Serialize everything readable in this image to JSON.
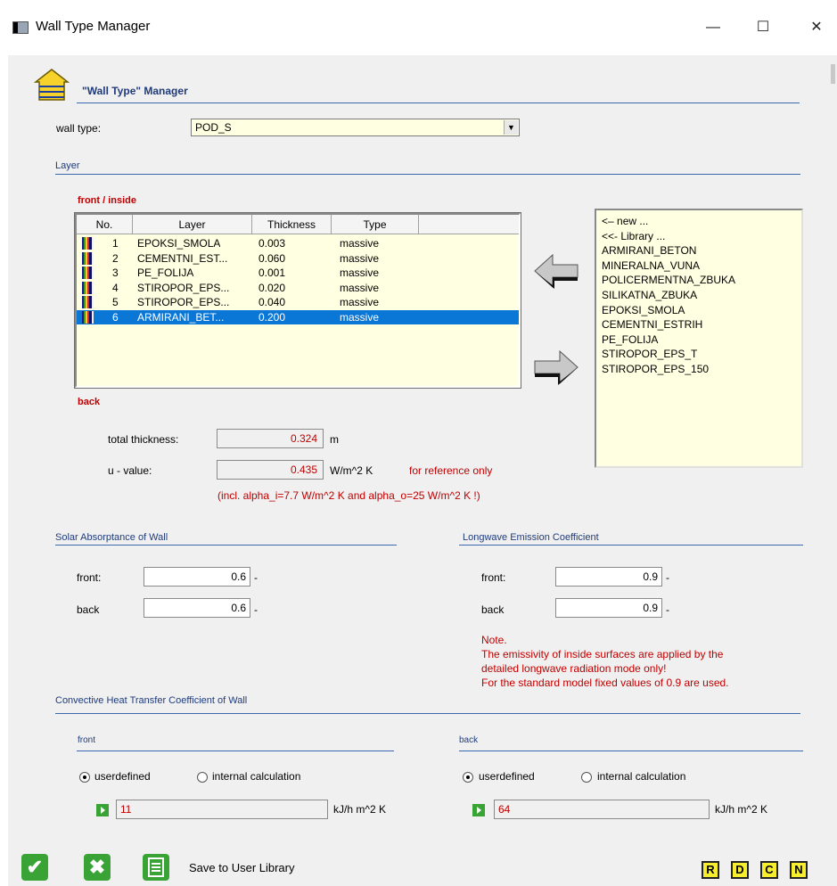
{
  "window": {
    "title": "Wall Type Manager",
    "minimize": "—",
    "maximize": "☐",
    "close": "✕"
  },
  "header": {
    "title": "\"Wall Type\" Manager",
    "icon": "house-icon"
  },
  "wall_type": {
    "label": "wall type:",
    "value": "POD_S"
  },
  "layer_section": {
    "title": "Layer",
    "front_label": "front / inside",
    "back_label": "back",
    "columns": [
      "No.",
      "Layer",
      "Thickness",
      "Type"
    ],
    "rows": [
      {
        "no": "1",
        "layer": "EPOKSI_SMOLA",
        "thickness": "0.003",
        "type": "massive"
      },
      {
        "no": "2",
        "layer": "CEMENTNI_EST...",
        "thickness": "0.060",
        "type": "massive"
      },
      {
        "no": "3",
        "layer": "PE_FOLIJA",
        "thickness": "0.001",
        "type": "massive"
      },
      {
        "no": "4",
        "layer": "STIROPOR_EPS...",
        "thickness": "0.020",
        "type": "massive"
      },
      {
        "no": "5",
        "layer": "STIROPOR_EPS...",
        "thickness": "0.040",
        "type": "massive"
      },
      {
        "no": "6",
        "layer": "ARMIRANI_BET...",
        "thickness": "0.200",
        "type": "massive"
      }
    ],
    "selected_row": 6
  },
  "library": {
    "items": [
      "<– new ...",
      "<<- Library ...",
      "ARMIRANI_BETON",
      "MINERALNA_VUNA",
      "POLICERMENTNA_ZBUKA",
      "SILIKATNA_ZBUKA",
      "EPOKSI_SMOLA",
      "CEMENTNI_ESTRIH",
      "PE_FOLIJA",
      "STIROPOR_EPS_T",
      "STIROPOR_EPS_150"
    ]
  },
  "totals": {
    "thickness_label": "total thickness:",
    "thickness_value": "0.324",
    "thickness_unit": "m",
    "u_label": "u - value:",
    "u_value": "0.435",
    "u_unit": "W/m^2 K",
    "u_note": "for reference only",
    "alpha_note": "(incl. alpha_i=7.7 W/m^2 K and alpha_o=25 W/m^2 K !)"
  },
  "solar": {
    "title": "Solar Absorptance of Wall",
    "front_label": "front:",
    "front_value": "0.6",
    "back_label": "back",
    "back_value": "0.6",
    "unit": "-"
  },
  "longwave": {
    "title": "Longwave Emission Coefficient",
    "front_label": "front:",
    "front_value": "0.9",
    "back_label": "back",
    "back_value": "0.9",
    "unit": "-",
    "note_title": "Note.",
    "note_line1": "The emissivity of inside surfaces are applied by the",
    "note_line2": "detailed longwave radiation mode only!",
    "note_line3": "For the standard model fixed values of 0.9 are used."
  },
  "convective": {
    "title": "Convective Heat Transfer Coefficient of Wall",
    "front": {
      "title": "front",
      "opt_user": "userdefined",
      "opt_calc": "internal calculation",
      "selected": "userdefined",
      "value": "11",
      "unit": "kJ/h m^2 K"
    },
    "back": {
      "title": "back",
      "opt_user": "userdefined",
      "opt_calc": "internal calculation",
      "selected": "userdefined",
      "value": "64",
      "unit": "kJ/h m^2 K"
    }
  },
  "footer": {
    "ok": "✔",
    "cancel": "✖",
    "save_label": "Save to User Library",
    "buttons": [
      "R",
      "D",
      "C",
      "N"
    ]
  },
  "colors": {
    "accent": "#1f3b7a",
    "note_red": "#c00000",
    "field_yellow": "#ffffe1",
    "selection": "#0a76d6",
    "icon_green": "#3aa335",
    "button_yellow": "#f7ee2d"
  }
}
